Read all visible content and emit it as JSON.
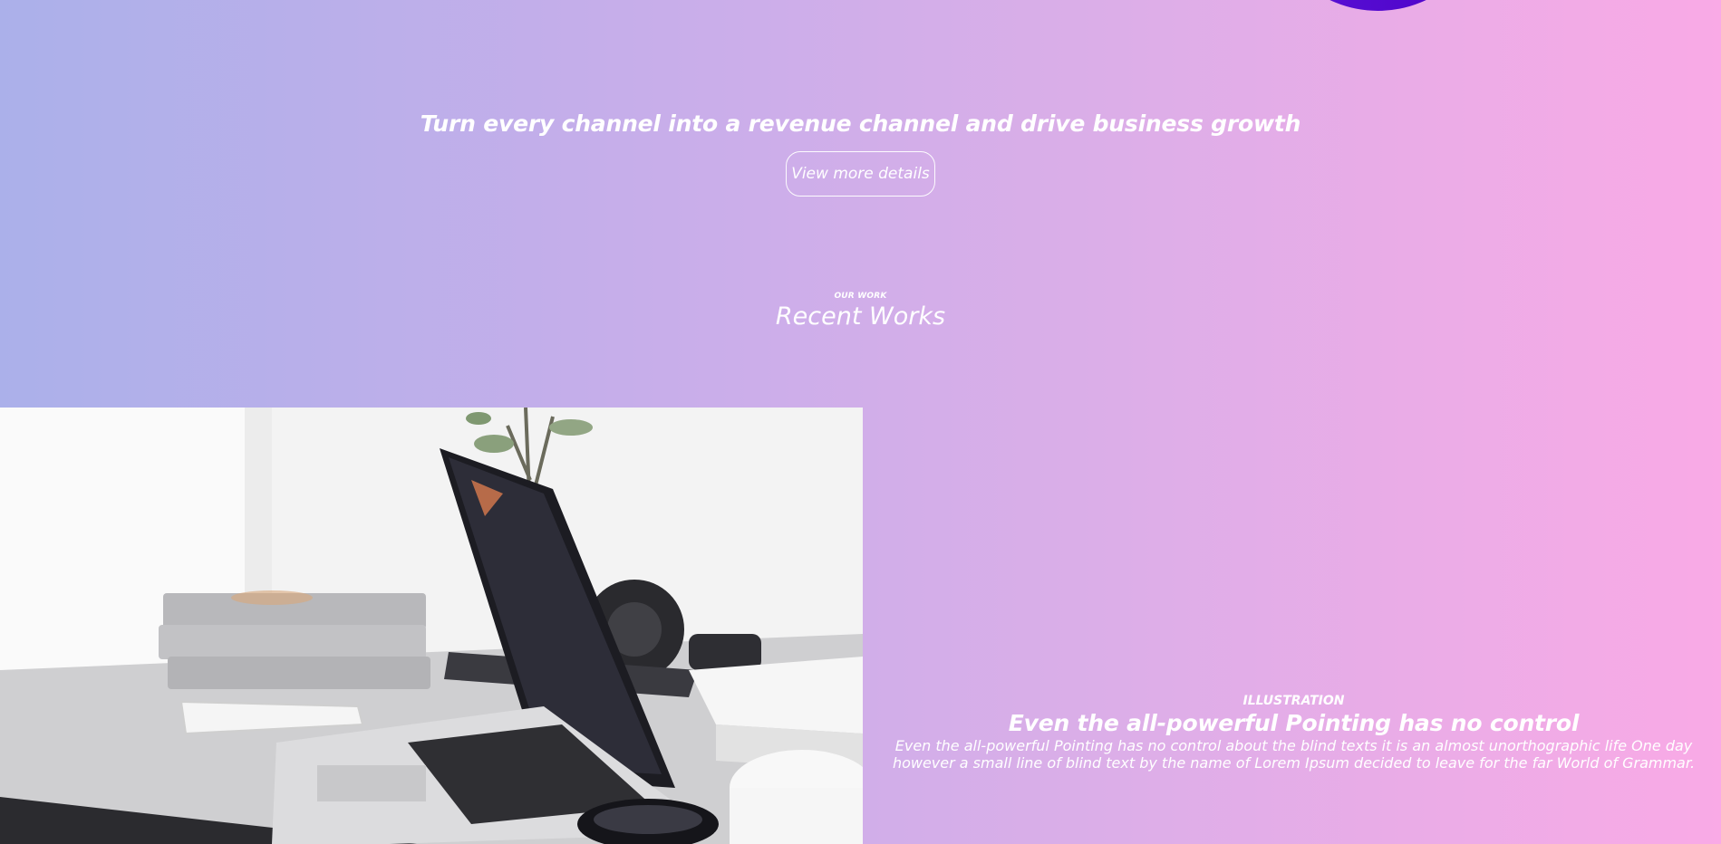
{
  "hero": {
    "title": "Turn every channel into a revenue channel and drive business growth",
    "button_label": "View more details"
  },
  "section": {
    "eyebrow": "OUR WORK",
    "title": "Recent Works"
  },
  "work": {
    "image_subject": "laptop-desk-photo",
    "category": "ILLUSTRATION",
    "title": "Even the all-powerful Pointing has no control",
    "description": "Even the all-powerful Pointing has no control about the blind texts it is an almost unorthographic life One day however a small line of blind text by the name of Lorem Ipsum decided to leave for the far World of Grammar."
  },
  "colors": {
    "gradient_left": "#abb0ea",
    "gradient_right": "#f9aae6",
    "blob": "#5a14d6",
    "text": "#ffffff"
  }
}
